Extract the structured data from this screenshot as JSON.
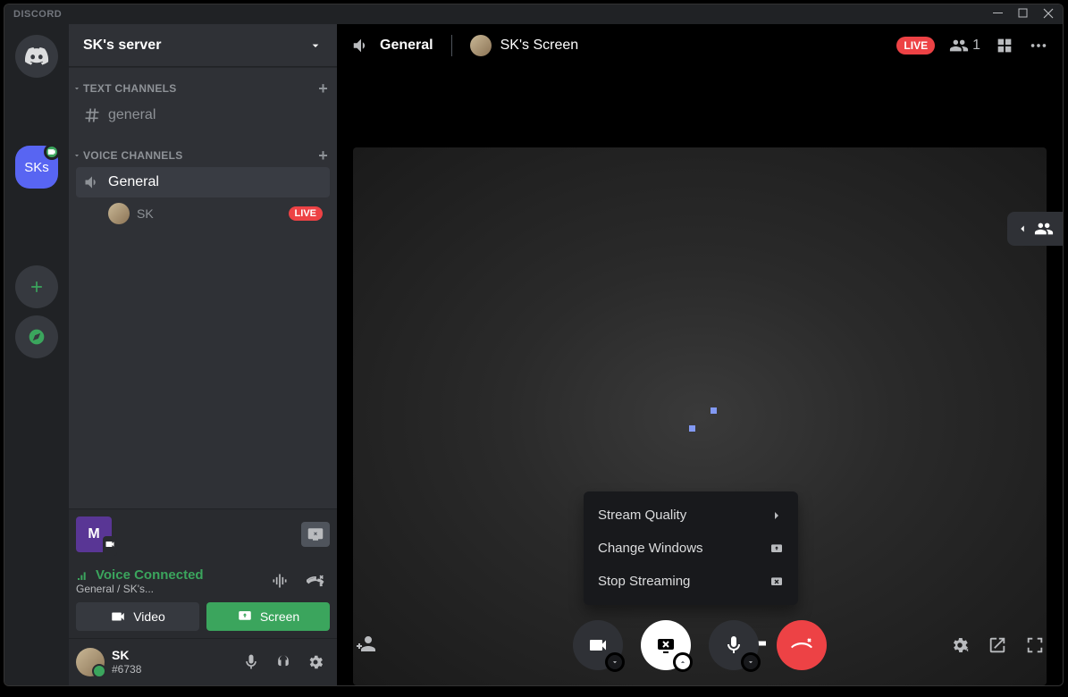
{
  "app_name": "DISCORD",
  "server": {
    "name": "SK's server",
    "short": "SKs"
  },
  "categories": {
    "text": {
      "label": "TEXT CHANNELS",
      "channels": [
        {
          "name": "general"
        }
      ]
    },
    "voice": {
      "label": "VOICE CHANNELS",
      "channels": [
        {
          "name": "General",
          "members": [
            {
              "name": "SK",
              "live": "LIVE"
            }
          ]
        }
      ]
    }
  },
  "voice_status": {
    "connected": "Voice Connected",
    "subtitle": "General / SK's...",
    "video_btn": "Video",
    "screen_btn": "Screen"
  },
  "activity": {
    "letter": "M"
  },
  "user": {
    "name": "SK",
    "tag": "#6738"
  },
  "header": {
    "channel": "General",
    "stream_title": "SK's Screen",
    "live": "LIVE",
    "viewers": "1"
  },
  "popup": {
    "quality": "Stream Quality",
    "change": "Change Windows",
    "stop": "Stop Streaming"
  }
}
